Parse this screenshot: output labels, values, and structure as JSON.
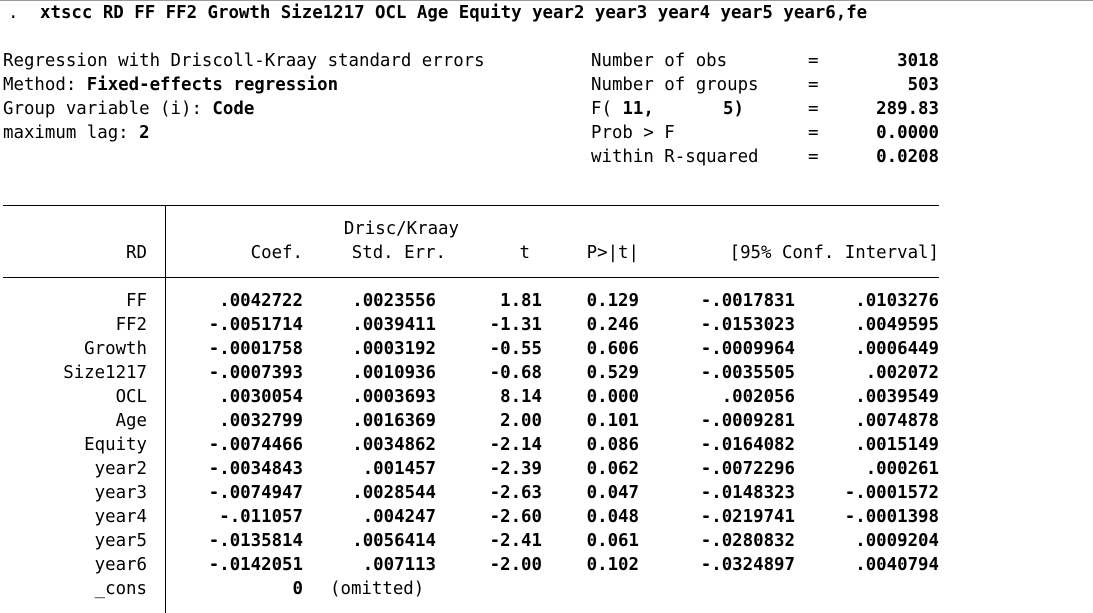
{
  "command": {
    "prompt": ".",
    "text": "xtscc RD FF FF2 Growth Size1217 OCL Age Equity year2 year3 year4 year5 year6,fe"
  },
  "header_left": [
    {
      "label": "Regression with Driscoll-Kraay standard errors",
      "value": ""
    },
    {
      "label": "Method: ",
      "value": "Fixed-effects regression"
    },
    {
      "label": "Group variable (i): ",
      "value": "Code"
    },
    {
      "label": "maximum lag: ",
      "value": "2"
    }
  ],
  "header_right": [
    {
      "label": "Number of obs",
      "eq": "=",
      "value": "3018"
    },
    {
      "label": "Number of groups",
      "eq": "=",
      "value": "503"
    },
    {
      "label_prefix": "F(",
      "df1": "11,",
      "df2": "5)",
      "eq": "=",
      "value": "289.83"
    },
    {
      "label": "Prob > F",
      "eq": "=",
      "value": "0.0000"
    },
    {
      "label": "within R-squared",
      "eq": "=",
      "value": "0.0208"
    }
  ],
  "table": {
    "depvar": "RD",
    "headers": {
      "coef": "Coef.",
      "se_top": "Drisc/Kraay",
      "se": "Std. Err.",
      "t": "t",
      "p": "P>|t|",
      "ci": "[95% Conf. Interval]"
    },
    "rows": [
      {
        "var": "FF",
        "coef": ".0042722",
        "se": ".0023556",
        "t": "1.81",
        "p": "0.129",
        "lo": "-.0017831",
        "hi": ".0103276"
      },
      {
        "var": "FF2",
        "coef": "-.0051714",
        "se": ".0039411",
        "t": "-1.31",
        "p": "0.246",
        "lo": "-.0153023",
        "hi": ".0049595"
      },
      {
        "var": "Growth",
        "coef": "-.0001758",
        "se": ".0003192",
        "t": "-0.55",
        "p": "0.606",
        "lo": "-.0009964",
        "hi": ".0006449"
      },
      {
        "var": "Size1217",
        "coef": "-.0007393",
        "se": ".0010936",
        "t": "-0.68",
        "p": "0.529",
        "lo": "-.0035505",
        "hi": ".002072"
      },
      {
        "var": "OCL",
        "coef": ".0030054",
        "se": ".0003693",
        "t": "8.14",
        "p": "0.000",
        "lo": ".002056",
        "hi": ".0039549"
      },
      {
        "var": "Age",
        "coef": ".0032799",
        "se": ".0016369",
        "t": "2.00",
        "p": "0.101",
        "lo": "-.0009281",
        "hi": ".0074878"
      },
      {
        "var": "Equity",
        "coef": "-.0074466",
        "se": ".0034862",
        "t": "-2.14",
        "p": "0.086",
        "lo": "-.0164082",
        "hi": ".0015149"
      },
      {
        "var": "year2",
        "coef": "-.0034843",
        "se": ".001457",
        "t": "-2.39",
        "p": "0.062",
        "lo": "-.0072296",
        "hi": ".000261"
      },
      {
        "var": "year3",
        "coef": "-.0074947",
        "se": ".0028544",
        "t": "-2.63",
        "p": "0.047",
        "lo": "-.0148323",
        "hi": "-.0001572"
      },
      {
        "var": "year4",
        "coef": "-.011057",
        "se": ".004247",
        "t": "-2.60",
        "p": "0.048",
        "lo": "-.0219741",
        "hi": "-.0001398"
      },
      {
        "var": "year5",
        "coef": "-.0135814",
        "se": ".0056414",
        "t": "-2.41",
        "p": "0.061",
        "lo": "-.0280832",
        "hi": ".0009204"
      },
      {
        "var": "year6",
        "coef": "-.0142051",
        "se": ".007113",
        "t": "-2.00",
        "p": "0.102",
        "lo": "-.0324897",
        "hi": ".0040794"
      }
    ],
    "cons": {
      "var": "_cons",
      "coef": "0",
      "note": "(omitted)"
    }
  }
}
